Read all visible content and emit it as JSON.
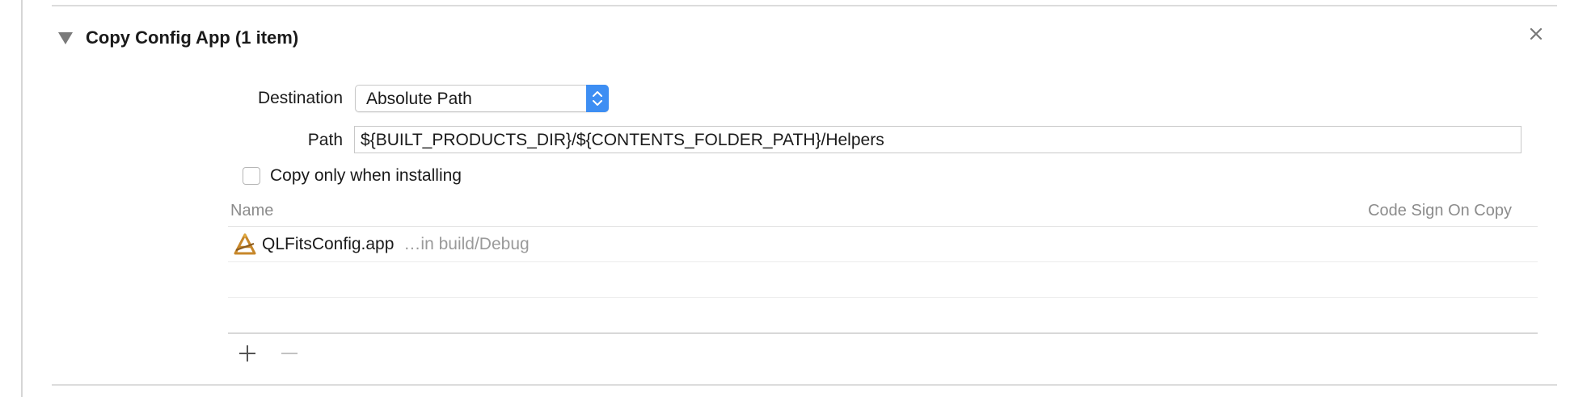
{
  "phase": {
    "title": "Copy Config App (1 item)"
  },
  "form": {
    "destination_label": "Destination",
    "destination_value": "Absolute Path",
    "path_label": "Path",
    "path_value": "${BUILT_PRODUCTS_DIR}/${CONTENTS_FOLDER_PATH}/Helpers",
    "copy_only_label": "Copy only when installing",
    "copy_only_checked": false
  },
  "table": {
    "columns": [
      "Name",
      "Code Sign On Copy"
    ],
    "rows": [
      {
        "icon": "app-icon",
        "name": "QLFitsConfig.app",
        "location": "…in build/Debug"
      }
    ]
  },
  "icons": {
    "disclosure": "disclosure-triangle-icon",
    "close": "close-icon",
    "stepper": "select-stepper-icon",
    "add": "plus-icon",
    "remove": "minus-icon"
  },
  "colors": {
    "accent": "#3d8ef3",
    "secondary_text": "#8c8c8c"
  }
}
